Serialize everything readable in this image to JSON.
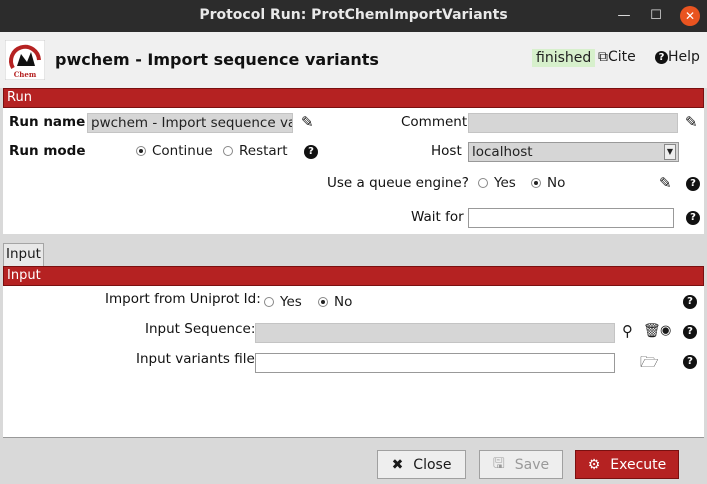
{
  "window": {
    "title": "Protocol Run: ProtChemImportVariants"
  },
  "header": {
    "protocol_title": "pwchem - Import sequence variants",
    "status": "finished",
    "cite_label": "Cite",
    "help_label": "Help",
    "logo_text": "Chem"
  },
  "run_section": {
    "title": "Run",
    "run_name_label": "Run name",
    "run_name_value": "pwchem - Import sequence varia",
    "comment_label": "Comment",
    "comment_value": "",
    "run_mode_label": "Run mode",
    "run_mode_options": [
      "Continue",
      "Restart"
    ],
    "run_mode_selected": "Continue",
    "host_label": "Host",
    "host_value": "localhost",
    "queue_label": "Use a queue engine?",
    "queue_options": [
      "Yes",
      "No"
    ],
    "queue_selected": "No",
    "wait_for_label": "Wait for",
    "wait_for_value": ""
  },
  "tabs": [
    {
      "label": "Input"
    }
  ],
  "input_section": {
    "title": "Input",
    "uniprot_label": "Import from Uniprot Id:",
    "uniprot_options": [
      "Yes",
      "No"
    ],
    "uniprot_selected": "No",
    "sequence_label": "Input Sequence:",
    "sequence_value": "",
    "variants_label": "Input variants file:",
    "variants_value": ""
  },
  "buttons": {
    "close": "Close",
    "save": "Save",
    "execute": "Execute"
  },
  "colors": {
    "section_bar": "#b52222",
    "status_bg": "#d7f0cc",
    "titlebar": "#2c2c2c",
    "close_button": "#e95420"
  }
}
